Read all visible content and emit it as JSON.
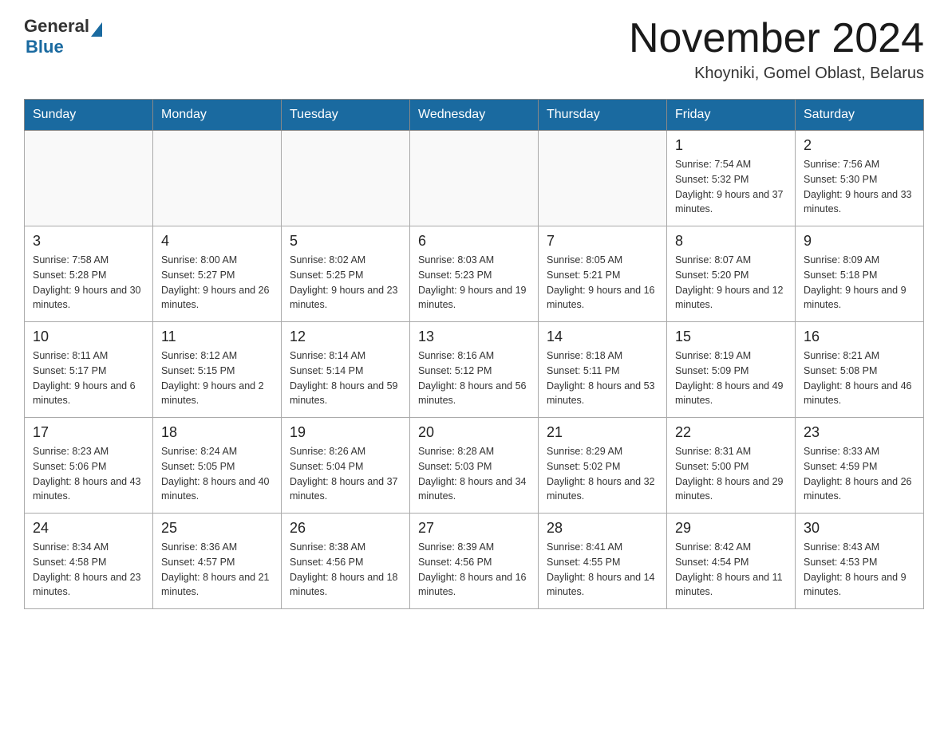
{
  "logo": {
    "text_general": "General",
    "text_blue": "Blue",
    "triangle_alt": "logo triangle"
  },
  "header": {
    "month_title": "November 2024",
    "location": "Khoyniki, Gomel Oblast, Belarus"
  },
  "weekdays": [
    "Sunday",
    "Monday",
    "Tuesday",
    "Wednesday",
    "Thursday",
    "Friday",
    "Saturday"
  ],
  "weeks": [
    [
      {
        "day": "",
        "sunrise": "",
        "sunset": "",
        "daylight": ""
      },
      {
        "day": "",
        "sunrise": "",
        "sunset": "",
        "daylight": ""
      },
      {
        "day": "",
        "sunrise": "",
        "sunset": "",
        "daylight": ""
      },
      {
        "day": "",
        "sunrise": "",
        "sunset": "",
        "daylight": ""
      },
      {
        "day": "",
        "sunrise": "",
        "sunset": "",
        "daylight": ""
      },
      {
        "day": "1",
        "sunrise": "Sunrise: 7:54 AM",
        "sunset": "Sunset: 5:32 PM",
        "daylight": "Daylight: 9 hours and 37 minutes."
      },
      {
        "day": "2",
        "sunrise": "Sunrise: 7:56 AM",
        "sunset": "Sunset: 5:30 PM",
        "daylight": "Daylight: 9 hours and 33 minutes."
      }
    ],
    [
      {
        "day": "3",
        "sunrise": "Sunrise: 7:58 AM",
        "sunset": "Sunset: 5:28 PM",
        "daylight": "Daylight: 9 hours and 30 minutes."
      },
      {
        "day": "4",
        "sunrise": "Sunrise: 8:00 AM",
        "sunset": "Sunset: 5:27 PM",
        "daylight": "Daylight: 9 hours and 26 minutes."
      },
      {
        "day": "5",
        "sunrise": "Sunrise: 8:02 AM",
        "sunset": "Sunset: 5:25 PM",
        "daylight": "Daylight: 9 hours and 23 minutes."
      },
      {
        "day": "6",
        "sunrise": "Sunrise: 8:03 AM",
        "sunset": "Sunset: 5:23 PM",
        "daylight": "Daylight: 9 hours and 19 minutes."
      },
      {
        "day": "7",
        "sunrise": "Sunrise: 8:05 AM",
        "sunset": "Sunset: 5:21 PM",
        "daylight": "Daylight: 9 hours and 16 minutes."
      },
      {
        "day": "8",
        "sunrise": "Sunrise: 8:07 AM",
        "sunset": "Sunset: 5:20 PM",
        "daylight": "Daylight: 9 hours and 12 minutes."
      },
      {
        "day": "9",
        "sunrise": "Sunrise: 8:09 AM",
        "sunset": "Sunset: 5:18 PM",
        "daylight": "Daylight: 9 hours and 9 minutes."
      }
    ],
    [
      {
        "day": "10",
        "sunrise": "Sunrise: 8:11 AM",
        "sunset": "Sunset: 5:17 PM",
        "daylight": "Daylight: 9 hours and 6 minutes."
      },
      {
        "day": "11",
        "sunrise": "Sunrise: 8:12 AM",
        "sunset": "Sunset: 5:15 PM",
        "daylight": "Daylight: 9 hours and 2 minutes."
      },
      {
        "day": "12",
        "sunrise": "Sunrise: 8:14 AM",
        "sunset": "Sunset: 5:14 PM",
        "daylight": "Daylight: 8 hours and 59 minutes."
      },
      {
        "day": "13",
        "sunrise": "Sunrise: 8:16 AM",
        "sunset": "Sunset: 5:12 PM",
        "daylight": "Daylight: 8 hours and 56 minutes."
      },
      {
        "day": "14",
        "sunrise": "Sunrise: 8:18 AM",
        "sunset": "Sunset: 5:11 PM",
        "daylight": "Daylight: 8 hours and 53 minutes."
      },
      {
        "day": "15",
        "sunrise": "Sunrise: 8:19 AM",
        "sunset": "Sunset: 5:09 PM",
        "daylight": "Daylight: 8 hours and 49 minutes."
      },
      {
        "day": "16",
        "sunrise": "Sunrise: 8:21 AM",
        "sunset": "Sunset: 5:08 PM",
        "daylight": "Daylight: 8 hours and 46 minutes."
      }
    ],
    [
      {
        "day": "17",
        "sunrise": "Sunrise: 8:23 AM",
        "sunset": "Sunset: 5:06 PM",
        "daylight": "Daylight: 8 hours and 43 minutes."
      },
      {
        "day": "18",
        "sunrise": "Sunrise: 8:24 AM",
        "sunset": "Sunset: 5:05 PM",
        "daylight": "Daylight: 8 hours and 40 minutes."
      },
      {
        "day": "19",
        "sunrise": "Sunrise: 8:26 AM",
        "sunset": "Sunset: 5:04 PM",
        "daylight": "Daylight: 8 hours and 37 minutes."
      },
      {
        "day": "20",
        "sunrise": "Sunrise: 8:28 AM",
        "sunset": "Sunset: 5:03 PM",
        "daylight": "Daylight: 8 hours and 34 minutes."
      },
      {
        "day": "21",
        "sunrise": "Sunrise: 8:29 AM",
        "sunset": "Sunset: 5:02 PM",
        "daylight": "Daylight: 8 hours and 32 minutes."
      },
      {
        "day": "22",
        "sunrise": "Sunrise: 8:31 AM",
        "sunset": "Sunset: 5:00 PM",
        "daylight": "Daylight: 8 hours and 29 minutes."
      },
      {
        "day": "23",
        "sunrise": "Sunrise: 8:33 AM",
        "sunset": "Sunset: 4:59 PM",
        "daylight": "Daylight: 8 hours and 26 minutes."
      }
    ],
    [
      {
        "day": "24",
        "sunrise": "Sunrise: 8:34 AM",
        "sunset": "Sunset: 4:58 PM",
        "daylight": "Daylight: 8 hours and 23 minutes."
      },
      {
        "day": "25",
        "sunrise": "Sunrise: 8:36 AM",
        "sunset": "Sunset: 4:57 PM",
        "daylight": "Daylight: 8 hours and 21 minutes."
      },
      {
        "day": "26",
        "sunrise": "Sunrise: 8:38 AM",
        "sunset": "Sunset: 4:56 PM",
        "daylight": "Daylight: 8 hours and 18 minutes."
      },
      {
        "day": "27",
        "sunrise": "Sunrise: 8:39 AM",
        "sunset": "Sunset: 4:56 PM",
        "daylight": "Daylight: 8 hours and 16 minutes."
      },
      {
        "day": "28",
        "sunrise": "Sunrise: 8:41 AM",
        "sunset": "Sunset: 4:55 PM",
        "daylight": "Daylight: 8 hours and 14 minutes."
      },
      {
        "day": "29",
        "sunrise": "Sunrise: 8:42 AM",
        "sunset": "Sunset: 4:54 PM",
        "daylight": "Daylight: 8 hours and 11 minutes."
      },
      {
        "day": "30",
        "sunrise": "Sunrise: 8:43 AM",
        "sunset": "Sunset: 4:53 PM",
        "daylight": "Daylight: 8 hours and 9 minutes."
      }
    ]
  ]
}
